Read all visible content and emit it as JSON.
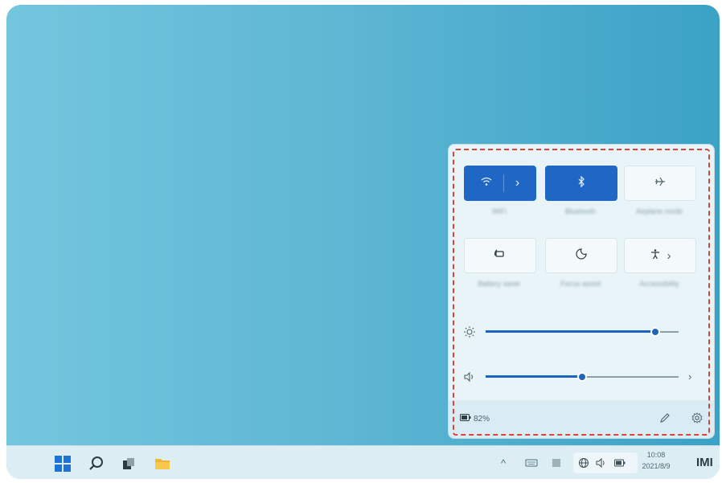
{
  "quick_settings": {
    "tiles_row1": [
      {
        "icon": "wifi-icon",
        "expand": "›",
        "label": "WiFi"
      },
      {
        "icon": "bluetooth-icon",
        "label": "Bluetooth"
      },
      {
        "icon": "airplane-mode-icon",
        "label": "Airplane mode"
      }
    ],
    "tiles_row2": [
      {
        "icon": "battery-saver-icon",
        "label": "Battery saver"
      },
      {
        "icon": "focus-assist-icon",
        "label": "Focus assist"
      },
      {
        "icon": "accessibility-icon",
        "expand": "›",
        "label": "Accessibility"
      }
    ],
    "brightness": {
      "icon": "sun-icon",
      "level_percent": 88
    },
    "volume": {
      "icon": "speaker-icon",
      "level_percent": 50,
      "expand": "›"
    },
    "battery_text": "82%",
    "accent": "#2067c5"
  },
  "taskbar": {
    "tray_chevron": "^",
    "clock_time": "10:08",
    "clock_date": "2021/8/9",
    "corner_label": "IMI"
  }
}
